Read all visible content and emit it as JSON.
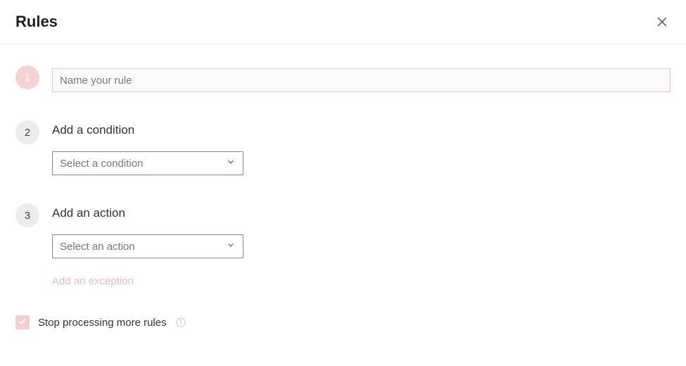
{
  "header": {
    "title": "Rules"
  },
  "steps": {
    "name": {
      "badge": "1",
      "placeholder": "Name your rule",
      "value": ""
    },
    "condition": {
      "badge": "2",
      "title": "Add a condition",
      "dropdown_text": "Select a condition"
    },
    "action": {
      "badge": "3",
      "title": "Add an action",
      "dropdown_text": "Select an action",
      "exception_label": "Add an exception"
    }
  },
  "footer": {
    "stop_processing_label": "Stop processing more rules",
    "stop_processing_checked": true
  }
}
